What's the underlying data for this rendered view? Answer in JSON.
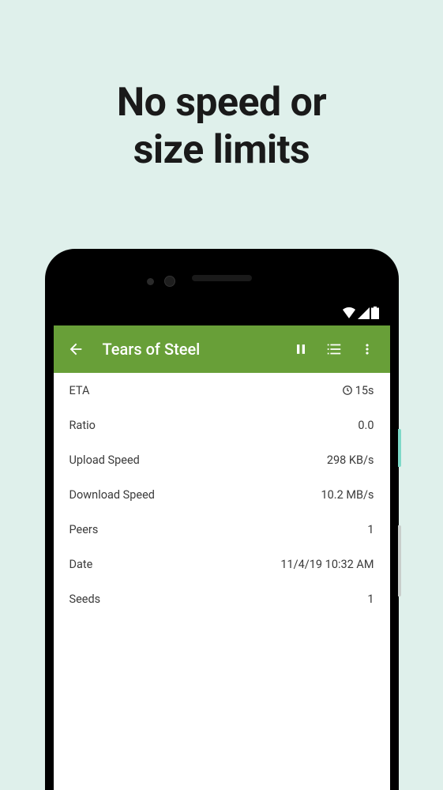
{
  "headline": {
    "line1": "No speed or",
    "line2": "size limits"
  },
  "header": {
    "title": "Tears of Steel"
  },
  "stats": {
    "eta": {
      "label": "ETA",
      "value": "15s"
    },
    "ratio": {
      "label": "Ratio",
      "value": "0.0"
    },
    "upload_speed": {
      "label": "Upload Speed",
      "value": "298 KB/s"
    },
    "download_speed": {
      "label": "Download Speed",
      "value": "10.2 MB/s"
    },
    "peers": {
      "label": "Peers",
      "value": "1"
    },
    "date": {
      "label": "Date",
      "value": "11/4/19 10:32 AM"
    },
    "seeds": {
      "label": "Seeds",
      "value": "1"
    }
  }
}
